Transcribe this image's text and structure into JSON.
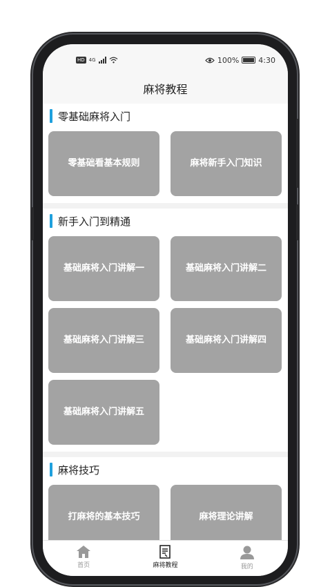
{
  "status_bar": {
    "network_label": "HD",
    "signal_label": "4G",
    "battery_percent": "100%",
    "time": "4:30"
  },
  "header": {
    "title": "麻将教程"
  },
  "sections": [
    {
      "title": "零基础麻将入门",
      "items": [
        {
          "label": "零基础看基本规则"
        },
        {
          "label": "麻将新手入门知识"
        }
      ]
    },
    {
      "title": "新手入门到精通",
      "items": [
        {
          "label": "基础麻将入门讲解一"
        },
        {
          "label": "基础麻将入门讲解二"
        },
        {
          "label": "基础麻将入门讲解三"
        },
        {
          "label": "基础麻将入门讲解四"
        },
        {
          "label": "基础麻将入门讲解五"
        }
      ]
    },
    {
      "title": "麻将技巧",
      "items": [
        {
          "label": "打麻将的基本技巧"
        },
        {
          "label": "麻将理论讲解"
        }
      ]
    }
  ],
  "tabbar": {
    "items": [
      {
        "label": "首页",
        "icon": "home-icon"
      },
      {
        "label": "麻将教程",
        "icon": "book-icon",
        "active": true
      },
      {
        "label": "我的",
        "icon": "user-icon"
      }
    ]
  },
  "colors": {
    "accent": "#1fa0dd",
    "card": "#a3a3a3",
    "background": "#f2f2f2"
  }
}
